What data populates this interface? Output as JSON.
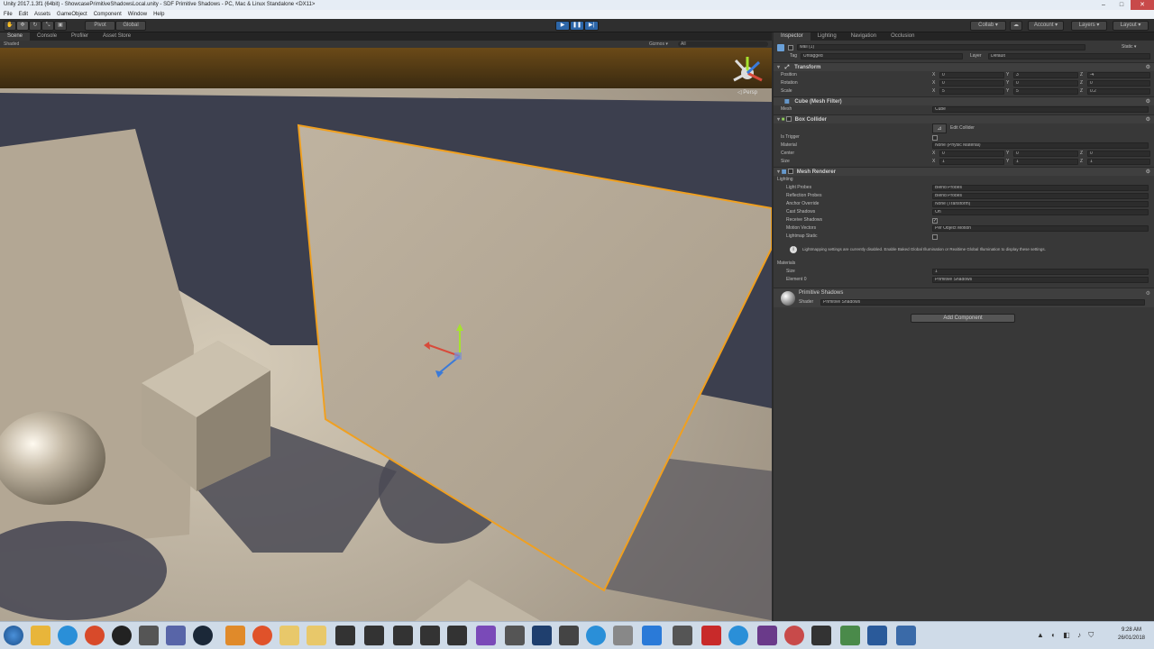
{
  "window": {
    "title": "Unity 2017.1.3f1 (64bit) - ShowcasePrimitiveShadowsLocal.unity - SDF Primitive Shadows - PC, Mac & Linux Standalone <DX11>",
    "minimize": "–",
    "maximize": "□",
    "close": "✕"
  },
  "menu": [
    "File",
    "Edit",
    "Assets",
    "GameObject",
    "Component",
    "Window",
    "Help"
  ],
  "toolbar": {
    "pivot": "Pivot",
    "space": "Global",
    "collab": "Collab ▾",
    "account": "Account ▾",
    "layers": "Layers ▾",
    "layout": "Layout ▾",
    "play": "▶",
    "pause": "❚❚",
    "step": "▶|"
  },
  "left_tabs": [
    "Scene",
    "Console",
    "Profiler",
    "Asset Store"
  ],
  "scene": {
    "shading": "Shaded",
    "gizmos": "Gizmos ▾",
    "search": "All",
    "persp": "◁ Persp"
  },
  "right_tabs": [
    "Inspector",
    "Lighting",
    "Navigation",
    "Occlusion"
  ],
  "object": {
    "name": "wall (1)",
    "static": "Static ▾",
    "tag_label": "Tag",
    "tag": "Untagged",
    "layer_label": "Layer",
    "layer": "Default"
  },
  "transform": {
    "title": "Transform",
    "position_label": "Position",
    "rotation_label": "Rotation",
    "scale_label": "Scale",
    "position": {
      "x": "0",
      "y": "3",
      "z": "-4"
    },
    "rotation": {
      "x": "0",
      "y": "0",
      "z": "0"
    },
    "scale": {
      "x": "5",
      "y": "5",
      "z": "0.2"
    }
  },
  "mesh_filter": {
    "title": "Cube (Mesh Filter)",
    "mesh_label": "Mesh",
    "mesh": "Cube"
  },
  "box_collider": {
    "title": "Box Collider",
    "edit": "Edit Collider",
    "trigger_label": "Is Trigger",
    "material_label": "Material",
    "material": "None (Physic Material)",
    "center_label": "Center",
    "size_label": "Size",
    "center": {
      "x": "0",
      "y": "0",
      "z": "0"
    },
    "size": {
      "x": "1",
      "y": "1",
      "z": "1"
    }
  },
  "mesh_renderer": {
    "title": "Mesh Renderer",
    "lighting": "Lighting",
    "light_probes_label": "Light Probes",
    "light_probes": "Blend Probes",
    "reflection_label": "Reflection Probes",
    "reflection": "Blend Probes",
    "anchor_label": "Anchor Override",
    "anchor": "None (Transform)",
    "cast_label": "Cast Shadows",
    "cast": "On",
    "receive_label": "Receive Shadows",
    "motion_label": "Motion Vectors",
    "motion": "Per Object Motion",
    "lightmap_label": "Lightmap Static",
    "info": "Lightmapping settings are currently disabled. Enable Baked Global Illumination or Realtime Global Illumination to display these settings.",
    "materials": "Materials",
    "size_label": "Size",
    "size": "1",
    "element_label": "Element 0",
    "element": "Primitive Shadows"
  },
  "material": {
    "name": "Primitive Shadows",
    "shader_label": "Shader",
    "shader": "Primitive Shadows"
  },
  "add_component": "Add Component",
  "clock": {
    "time": "9:28 AM",
    "date": "26/01/2018"
  },
  "colors": {
    "selection": "#f0a020",
    "floor_wall": "#a89c88",
    "backdrop": "#3c3f4e",
    "orange_grid": "#5a3d12"
  }
}
